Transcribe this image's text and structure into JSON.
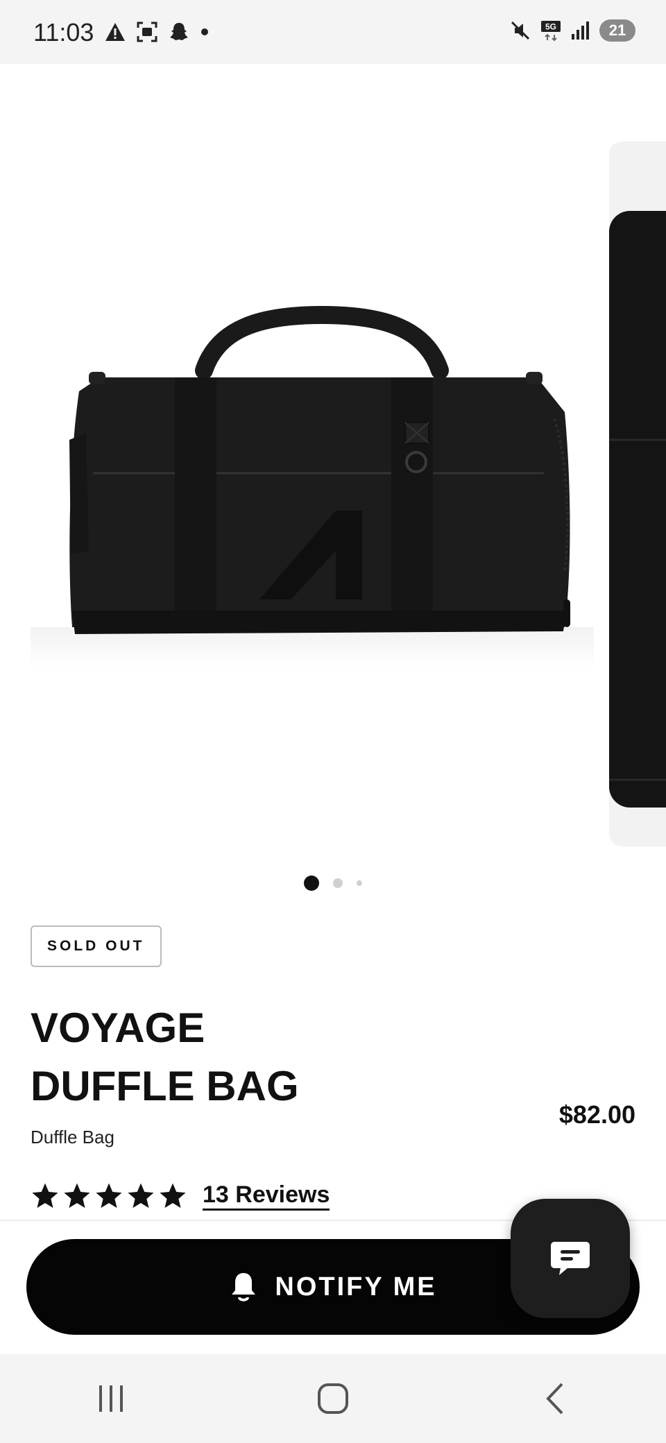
{
  "status_bar": {
    "time": "11:03",
    "left_icons": [
      "warning-icon",
      "screenshot-icon",
      "snapchat-icon",
      "dot-icon"
    ],
    "right_icons": [
      "mute-icon",
      "5g-icon",
      "signal-icon"
    ],
    "network": "5G",
    "battery": "21"
  },
  "gallery": {
    "slide_count": 3,
    "active_index": 0
  },
  "product": {
    "badge": "SOLD OUT",
    "title_line1": "VOYAGE",
    "title_line2": "DUFFLE BAG",
    "subtitle": "Duffle Bag",
    "price": "$82.00",
    "rating_stars": 5,
    "reviews_label": "13 Reviews"
  },
  "actions": {
    "notify_label": "NOTIFY ME",
    "notify_icon": "bell-icon",
    "chat_icon": "chat-bubble-icon"
  },
  "nav_bar": {
    "buttons": [
      "recents-icon",
      "home-icon",
      "back-icon"
    ]
  },
  "colors": {
    "primary": "#050505",
    "background": "#ffffff",
    "system_bar": "#f4f4f4"
  }
}
